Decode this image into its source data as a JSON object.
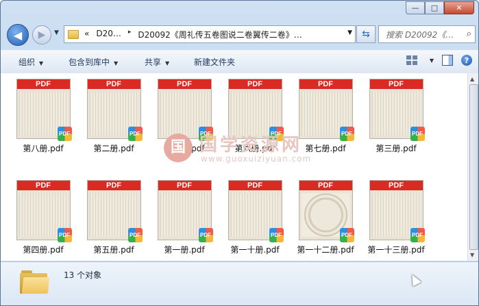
{
  "window": {
    "caption_buttons": {
      "minimize": "—",
      "maximize": "□",
      "close": "✕"
    }
  },
  "nav": {
    "back_icon": "arrow-left-icon",
    "forward_icon": "arrow-right-icon",
    "address_segments": [
      "«",
      "D20…",
      "▸",
      "D20092《周礼传五卷图说二卷翼传二卷》…"
    ],
    "search_placeholder": "搜索 D20092《…"
  },
  "toolbar": {
    "organize": "组织",
    "include_in_library": "包含到库中",
    "share": "共享",
    "new_folder": "新建文件夹"
  },
  "files": [
    {
      "name": "第八册.pdf",
      "band": "PDF",
      "badge": "PDF"
    },
    {
      "name": "第二册.pdf",
      "band": "PDF",
      "badge": "PDF"
    },
    {
      "name": "第九册.pdf",
      "band": "PDF",
      "badge": "PDF"
    },
    {
      "name": "第六册.pdf",
      "band": "PDF",
      "badge": "PDF"
    },
    {
      "name": "第七册.pdf",
      "band": "PDF",
      "badge": "PDF"
    },
    {
      "name": "第三册.pdf",
      "band": "PDF",
      "badge": "PDF"
    },
    {
      "name": "第四册.pdf",
      "band": "PDF",
      "badge": "PDF"
    },
    {
      "name": "第五册.pdf",
      "band": "PDF",
      "badge": "PDF"
    },
    {
      "name": "第一册.pdf",
      "band": "PDF",
      "badge": "PDF"
    },
    {
      "name": "第一十册.pdf",
      "band": "PDF",
      "badge": "PDF"
    },
    {
      "name": "第一十二册.pdf",
      "band": "PDF",
      "badge": "PDF"
    },
    {
      "name": "第一十三册.pdf",
      "band": "PDF",
      "badge": "PDF"
    }
  ],
  "watermark": {
    "logo": "国",
    "cn": "国学资源网",
    "en": "www.guoxuiziyuan.com"
  },
  "status": {
    "count_text": "13 个对象"
  }
}
